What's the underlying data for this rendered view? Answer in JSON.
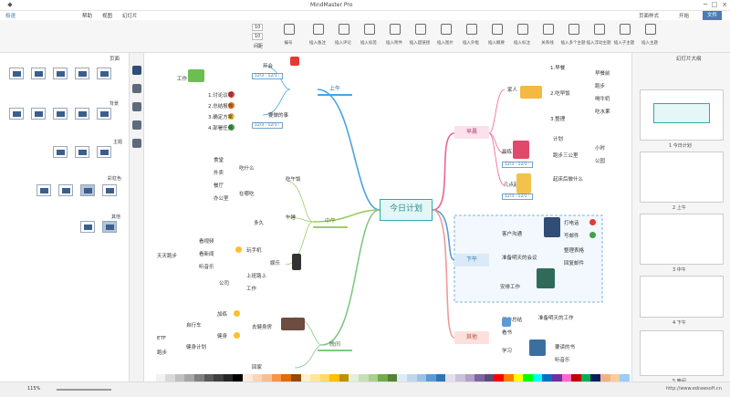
{
  "window": {
    "title": "MindMaster Pro",
    "min": "─",
    "max": "□",
    "close": "×"
  },
  "menu": {
    "file": "文件",
    "items": [
      "开始",
      "页面样式",
      "幻灯片",
      "视图",
      "帮助"
    ],
    "ai_btn": "极速"
  },
  "ribbon": {
    "buttons": [
      "插入主题",
      "插入子主题",
      "插入浮动主题",
      "插入多个主题",
      "关系线",
      "插入标注",
      "插入概要",
      "插入外框",
      "插入图片",
      "插入超链接",
      "插入附件",
      "插入标签",
      "插入评论",
      "插入备注",
      "编号"
    ],
    "font_size_a": "10",
    "font_size_b": "10",
    "spacing_label": "间距"
  },
  "left_panel": {
    "title": "页面",
    "background_label": "背景",
    "theme_label": "主题",
    "rainbow_label": "彩虹色",
    "other_label": "其他"
  },
  "right_panel": {
    "title": "幻灯片大纲",
    "thumbs": [
      "1 今日计划",
      "2 上午",
      "3 中午",
      "4 下午",
      "5 晚间"
    ]
  },
  "mindmap": {
    "center": "今日计划",
    "topics": {
      "morning": "早晨",
      "forenoon": "上午",
      "noon": "中午",
      "afternoon": "下午",
      "evening": "晚间",
      "other": "其他"
    },
    "morning_items": [
      "1.早餐",
      "2.吃早饭",
      "3.整理",
      "早餐前",
      "跑步",
      "喝牛奶",
      "吃水果",
      "家人",
      "晨练",
      "跑步三公里",
      "几点起床",
      "起床后做什么",
      "计划",
      "小时",
      "公园"
    ],
    "dates": [
      "12/3 : 12/1 :",
      "12/3 : 12/1 :",
      "12/3 : 12/1 :",
      "12/3 : 12/1 :"
    ],
    "forenoon_items": [
      "开会",
      "工作",
      "要做的事",
      "工作",
      "1.讨论议程",
      "2.总结报告",
      "3.确定方案",
      "4.部署任务",
      "开发计划"
    ],
    "noon_items": [
      "吃午饭",
      "吃什么",
      "在哪吃",
      "食堂",
      "外卖",
      "餐厅",
      "午睡",
      "多久",
      "娱乐",
      "玩手机",
      "看视频",
      "看新闻",
      "听音乐",
      "上班路上",
      "办公室",
      "公司",
      "天天跑步",
      "工作"
    ],
    "afternoon_items": [
      "客户沟通",
      "下午茶会议",
      "打电话",
      "写邮件",
      "整理表格",
      "准备明天的会议",
      "回复邮件",
      "联系客户",
      "安排工作",
      "联系供应商"
    ],
    "evening_items": [
      "去健身房",
      "运动",
      "加练",
      "健身",
      "自行车",
      "健身计划",
      "ETF",
      "跑步",
      "回家",
      "做饭",
      "洗碗"
    ],
    "other_items": [
      "工作总结",
      "准备明天的工作",
      "看书",
      "学习",
      "要读的书",
      "听音乐"
    ]
  },
  "status": {
    "zoom": "115%",
    "link": "http://www.edrawsoft.cn"
  }
}
